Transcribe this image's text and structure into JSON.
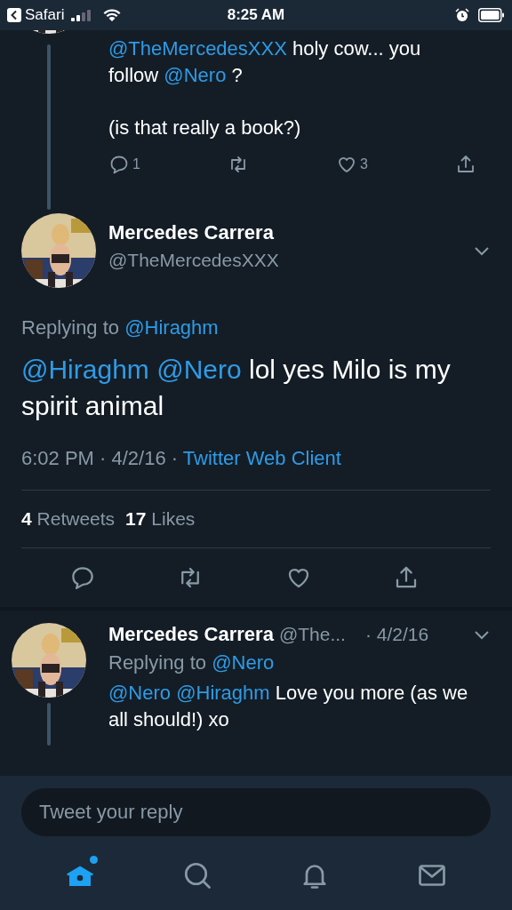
{
  "status_bar": {
    "back_app": "Safari",
    "time": "8:25 AM"
  },
  "parent_tweet": {
    "body": [
      {
        "kind": "mention",
        "text": "@TheMercedesXXX"
      },
      {
        "kind": "text",
        "text": " holy cow... you follow "
      },
      {
        "kind": "mention",
        "text": "@Nero"
      },
      {
        "kind": "text",
        "text": " ?"
      }
    ],
    "body_2": "(is that really a book?)",
    "actions": [
      {
        "kind": "reply",
        "count": "1"
      },
      {
        "kind": "retweet"
      },
      {
        "kind": "like",
        "count": "3"
      },
      {
        "kind": "share"
      }
    ]
  },
  "main_tweet": {
    "name": "Mercedes Carrera",
    "handle": "@TheMercedesXXX",
    "replying_label": "Replying to",
    "replying_to": "@Hiraghm",
    "body": [
      {
        "kind": "mention",
        "text": "@Hiraghm"
      },
      {
        "kind": "mention",
        "text": "@Nero"
      },
      {
        "kind": "text",
        "text": " lol yes Milo is my spirit animal"
      }
    ],
    "time": "6:02 PM · 4/2/16 · ",
    "client": "Twitter Web Client",
    "stats": [
      {
        "count": "4",
        "label": "Retweets"
      },
      {
        "count": "17",
        "label": "Likes"
      }
    ],
    "actions": [
      {
        "kind": "reply"
      },
      {
        "kind": "retweet"
      },
      {
        "kind": "like"
      },
      {
        "kind": "share"
      }
    ]
  },
  "reply_tweet": {
    "name": "Mercedes Carrera",
    "handle": "@The...",
    "date": "· 4/2/16",
    "replying_label": "Replying to",
    "replying_to": "@Nero",
    "body": [
      {
        "kind": "mention",
        "text": "@Nero"
      },
      {
        "kind": "mention",
        "text": "@Hiraghm"
      },
      {
        "kind": "text",
        "text": " Love you more (as we all should!) xo"
      }
    ]
  },
  "reply_field": {
    "placeholder": "Tweet your reply"
  },
  "tab_bar": [
    {
      "kind": "home",
      "selected": true
    },
    {
      "kind": "search",
      "selected": false
    },
    {
      "kind": "notifications",
      "selected": false
    },
    {
      "kind": "messages",
      "selected": false
    }
  ]
}
